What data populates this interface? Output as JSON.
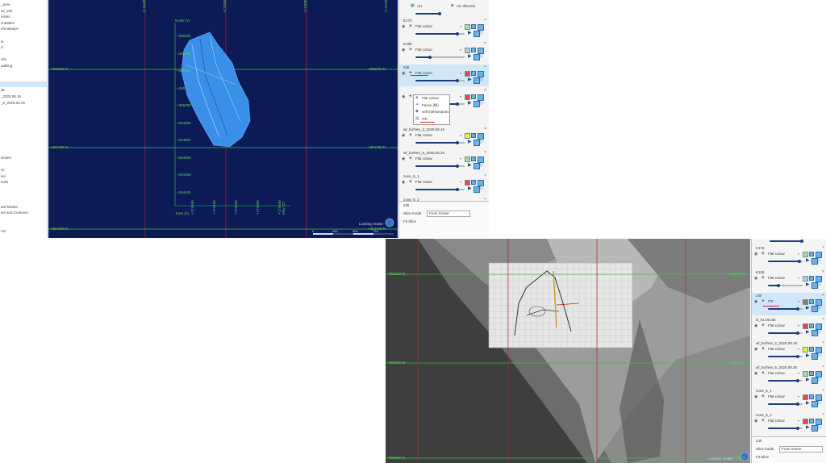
{
  "sidebar": {
    "items": [
      {
        "label": "_area",
        "sel": false
      },
      {
        "label": "es_ssh",
        "sel": false
      },
      {
        "label": "nisles",
        "sel": false
      },
      {
        "label": "chMdtes",
        "sel": false
      },
      {
        "label": "ehmelation",
        "sel": false
      },
      {
        "label": "",
        "sel": false
      },
      {
        "label": "ie",
        "sel": false
      },
      {
        "label": "d",
        "sel": false
      },
      {
        "label": "",
        "sel": false
      },
      {
        "label": "nils",
        "sel": false
      },
      {
        "label": "aalking",
        "sel": false
      },
      {
        "label": "",
        "sel": false
      },
      {
        "label": "",
        "sel": false
      },
      {
        "label": "",
        "sel": true
      },
      {
        "label": "de",
        "sel": false
      },
      {
        "label": "_2025.08.16",
        "sel": false
      },
      {
        "label": "_5_2025.08.25",
        "sel": false
      },
      {
        "label": "",
        "sel": false
      },
      {
        "label": "",
        "sel": false
      },
      {
        "label": "",
        "sel": false
      },
      {
        "label": "",
        "sel": false
      },
      {
        "label": "",
        "sel": false
      },
      {
        "label": "",
        "sel": false
      },
      {
        "label": "",
        "sel": false
      },
      {
        "label": "",
        "sel": false
      },
      {
        "label": "ieiolen",
        "sel": false
      },
      {
        "label": "",
        "sel": false
      },
      {
        "label": "ss",
        "sel": false
      },
      {
        "label": "ies",
        "sel": false
      },
      {
        "label": "inals",
        "sel": false
      },
      {
        "label": "",
        "sel": false
      },
      {
        "label": "",
        "sel": false
      },
      {
        "label": "",
        "sel": false
      },
      {
        "label": "ard Modes",
        "sel": false
      },
      {
        "label": "ies and Contours",
        "sel": false
      },
      {
        "label": "",
        "sel": false
      },
      {
        "label": "",
        "sel": false
      },
      {
        "label": "ots",
        "sel": false
      }
    ]
  },
  "top_view": {
    "north_label": "North (Y)",
    "north_ticks": [
      "+355400",
      "+355350",
      "+355300",
      "+355",
      "+355300",
      "+354850",
      "+354850",
      "+354800",
      "+354450",
      "+354400"
    ],
    "east_ticks": [
      "+174460",
      "+174480",
      "+174500",
      "+174500",
      "+174640"
    ],
    "east_caption": "East (X)",
    "easting_caption": "Elev (Z)",
    "grid_h_labels": [
      "+355000 N",
      "+354700 N",
      "+354400 N"
    ],
    "grid_h_labels_right": [
      "+355000 N",
      "+354700 N",
      "+354400 N"
    ],
    "grid_v_labels": [
      "+174400 E",
      "+174500 E",
      "+174500 E",
      "+174700 E"
    ],
    "looking": "Looking: Down",
    "scale_labels": [
      "0",
      "250",
      "500",
      "750"
    ]
  },
  "top_panel": {
    "header_row": {
      "label": "AU",
      "mode": "AU discrete"
    },
    "layers": [
      {
        "name": "E175",
        "mode": "Flat colour",
        "swatch": "#9be09b",
        "slider": 0.85
      },
      {
        "name": "E185",
        "mode": "Flat colour",
        "swatch": "#a9cfe8",
        "slider": 0.3
      },
      {
        "name": "24lt",
        "mode": "Flat colour",
        "swatch": "#e14a4a",
        "slider": 0.85,
        "highlighted": true
      },
      {
        "name": "",
        "mode": "Flat colour",
        "swatch": "#e14a4a",
        "slider": 0.85,
        "sub": true
      }
    ],
    "popup_items": [
      "Flat colour",
      "Faces (fill)",
      "self intersections",
      "IT8"
    ],
    "layers2": [
      {
        "name": "wf_borhen_2_2025.08.16",
        "mode": "Flat colour",
        "swatch": "#f3f03a",
        "slider": 0.85
      },
      {
        "name": "wf_borhen_5_2025.08.25",
        "mode": "Flat colour",
        "swatch": "#9be09b",
        "slider": 0.85
      },
      {
        "name": "zone_5_1",
        "mode": "Flat colour",
        "swatch": "#e14a4a",
        "slider": 0.85
      },
      {
        "name": "zone_5_2",
        "mode": "Flat colour",
        "swatch": "#e14a4a",
        "slider": 0.85
      }
    ],
    "footer": {
      "title": "24lt",
      "slice_label": "Slice mode",
      "slice_value": "From Scene",
      "fit_label": "Fit Slice"
    }
  },
  "bottom_view": {
    "grid_h_labels": [
      "+355200 N",
      "+355000 N",
      "+354800 N"
    ],
    "grid_h_labels_right": [
      "+355200 N",
      "+355000 N",
      "+354800 N"
    ],
    "looking": "Looking: Down"
  },
  "bottom_panel": {
    "layers": [
      {
        "name": "E175",
        "mode": "Flat colour",
        "swatch": "#9be09b",
        "slider": 0.9
      },
      {
        "name": "E185",
        "mode": "Flat colour",
        "swatch": "#a9cfe8",
        "slider": 0.3
      },
      {
        "name": "24lt",
        "mode": "IT8",
        "swatch": "#8b7a6a",
        "slider": 0.85,
        "highlighted": true
      },
      {
        "name": "lit_01.08.25t",
        "mode": "Flat colour",
        "swatch": "#e14a4a",
        "slider": 0.85
      },
      {
        "name": "wf_borhen_2_2025.08.16",
        "mode": "Flat colour",
        "swatch": "#f3f03a",
        "slider": 0.85
      },
      {
        "name": "wf_borhen_5_2025.08.25",
        "mode": "Flat colour",
        "swatch": "#9be09b",
        "slider": 0.85
      },
      {
        "name": "zone_5_1",
        "mode": "Flat colour",
        "swatch": "#e14a4a",
        "slider": 0.85
      },
      {
        "name": "zone_5_2",
        "mode": "Flat colour",
        "swatch": "#e14a4a",
        "slider": 0.85
      }
    ],
    "footer": {
      "title": "24lt",
      "slice_label": "Slice mode",
      "slice_value": "From Scene",
      "fit_label": "Fit Slice"
    }
  },
  "colors": {
    "viewport_bg": "#0c1a55",
    "grid_green": "#3fbf3f",
    "grid_red": "#c0202a",
    "mesh_blue": "#3a8fe8",
    "highlight": "#cfe7f8"
  }
}
